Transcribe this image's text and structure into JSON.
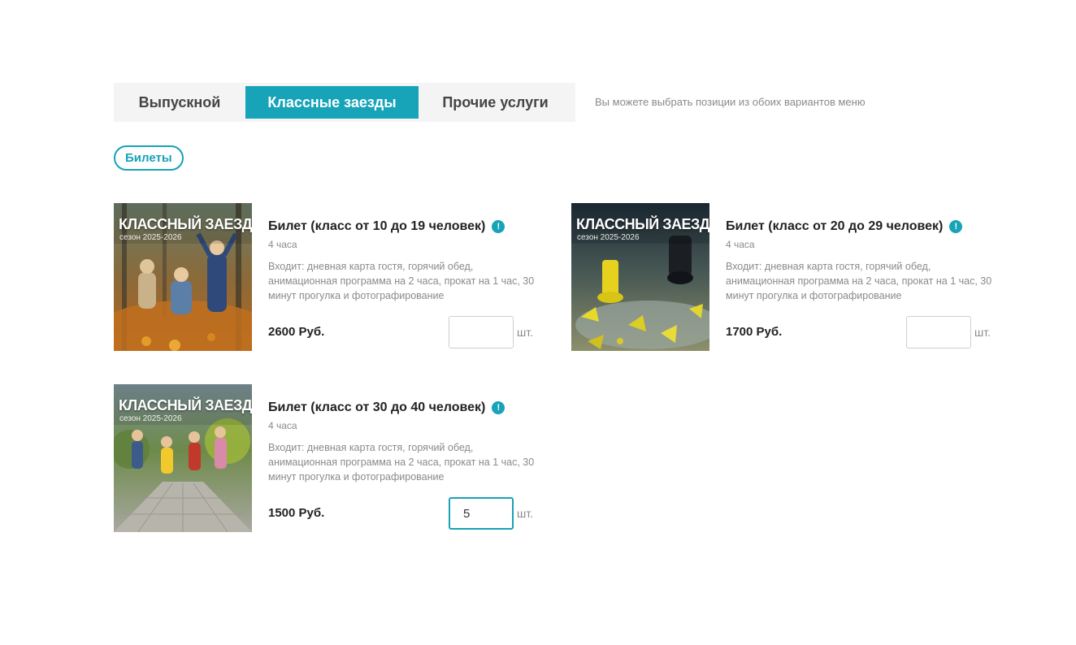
{
  "tabs": [
    {
      "label": "Выпускной"
    },
    {
      "label": "Классные заезды"
    },
    {
      "label": "Прочие услуги"
    }
  ],
  "tabs_hint": "Вы можете выбрать позиции из обоих вариантов меню",
  "category_pill": "Билеты",
  "accent_color": "#17a3b8",
  "cards": [
    {
      "thumb_title": "КЛАССНЫЙ ЗАЕЗД",
      "thumb_subtitle": "сезон 2025-2026",
      "title": "Билет (класс от 10 до 19 человек)",
      "info_icon": "!",
      "duration": "4 часа",
      "description": "Входит: дневная карта гостя, горячий обед, анимационная программа на 2 часа, прокат на 1 час, 30 минут прогулка и фотографирование",
      "price": "2600 Руб.",
      "quantity": "",
      "unit": "шт."
    },
    {
      "thumb_title": "КЛАССНЫЙ ЗАЕЗД",
      "thumb_subtitle": "сезон 2025-2026",
      "title": "Билет (класс от 20 до 29 человек)",
      "info_icon": "!",
      "duration": "4 часа",
      "description": "Входит: дневная карта гостя, горячий обед, анимационная программа на 2 часа, прокат на 1 час, 30 минут прогулка и фотографирование",
      "price": "1700 Руб.",
      "quantity": "",
      "unit": "шт."
    },
    {
      "thumb_title": "КЛАССНЫЙ ЗАЕЗД",
      "thumb_subtitle": "сезон 2025-2026",
      "title": "Билет (класс от 30 до 40 человек)",
      "info_icon": "!",
      "duration": "4 часа",
      "description": "Входит: дневная карта гостя, горячий обед, анимационная программа на 2 часа, прокат на 1 час, 30 минут прогулка и фотографирование",
      "price": "1500 Руб.",
      "quantity": "5",
      "unit": "шт."
    }
  ]
}
